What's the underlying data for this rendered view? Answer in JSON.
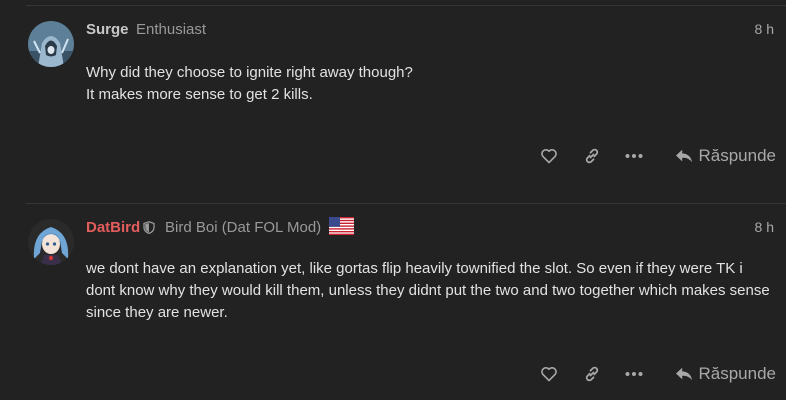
{
  "posts": [
    {
      "username": "Surge",
      "user_title": "Enthusiast",
      "username_color": "#c8c8c8",
      "avatar_icon": "hooded-figure-avatar",
      "time": "8 h",
      "lines": [
        "Why did they choose to ignite right away though?",
        "It makes more sense to get 2 kills."
      ],
      "actions": {
        "like_icon": "heart-icon",
        "link_icon": "link-icon",
        "more_icon": "ellipsis-icon",
        "reply_label": "Răspunde"
      }
    },
    {
      "username": "DatBird",
      "user_title": "Bird Boi (Dat FOL Mod)",
      "username_color": "#e45d5d",
      "avatar_icon": "blue-haired-character-avatar",
      "badge_icon": "shield-icon",
      "flag_icon": "us-flag-icon",
      "time": "8 h",
      "lines": [
        "we dont have an explanation yet, like gortas flip heavily townified the slot. So even if they were TK i",
        "dont know why they would kill them, unless they didnt put the two and two together which makes sense",
        "since they are newer."
      ],
      "actions": {
        "like_icon": "heart-icon",
        "link_icon": "link-icon",
        "more_icon": "ellipsis-icon",
        "reply_label": "Răspunde"
      }
    }
  ],
  "colors": {
    "background": "#222222",
    "muted": "#a8a8a8",
    "text": "#e2e2e2"
  }
}
